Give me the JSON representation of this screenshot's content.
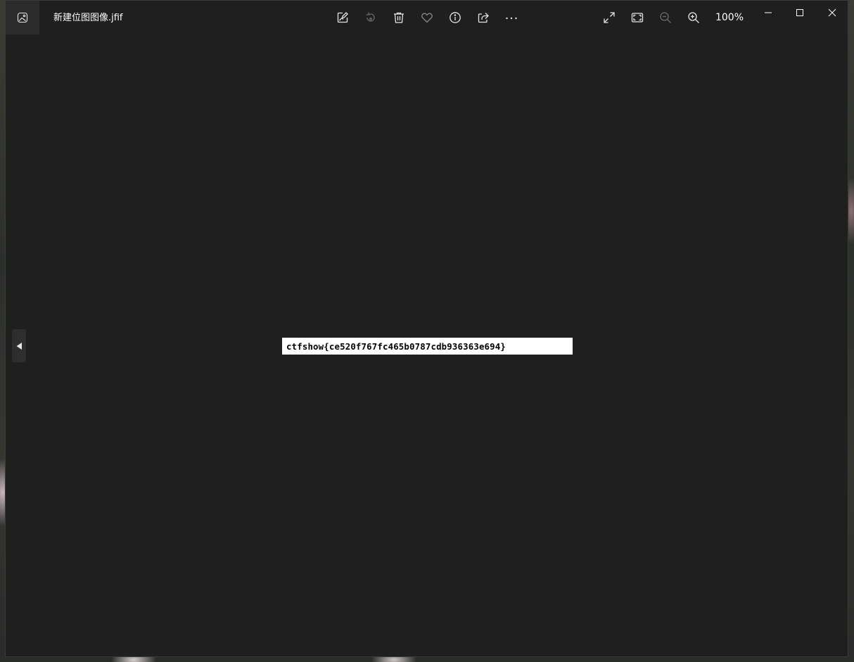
{
  "window": {
    "title": "新建位图图像.jfif",
    "zoom": "100%"
  },
  "toolbar": {
    "icons": [
      "edit-image-icon",
      "rotate-icon",
      "delete-icon",
      "favorite-heart-icon",
      "info-icon",
      "share-icon",
      "more-icon",
      "fullscreen-icon",
      "fit-to-window-icon",
      "zoom-out-icon",
      "zoom-in-icon"
    ]
  },
  "window_controls": {
    "icons": [
      "minimize-icon",
      "maximize-icon",
      "close-icon"
    ]
  },
  "image": {
    "text": "ctfshow{ce520f767fc465b0787cdb936363e694}"
  },
  "colors": {
    "window_bg": "#1f1f1f",
    "icon": "#e6e6e6",
    "icon_disabled": "#6a6a6a",
    "image_bg": "#ffffff",
    "image_text": "#000000"
  }
}
